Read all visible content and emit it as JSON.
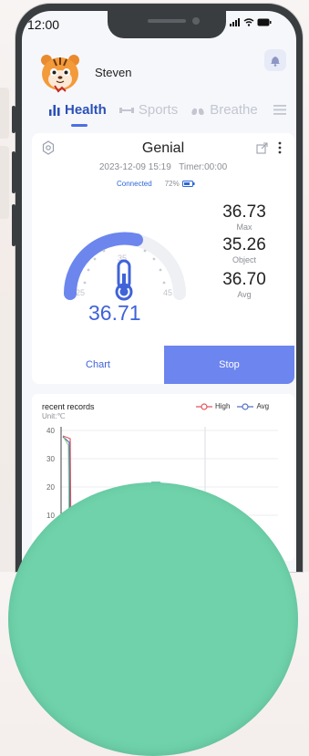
{
  "status_bar": {
    "time": "12:00"
  },
  "user": {
    "name": "Steven"
  },
  "tabs": [
    {
      "label": "Health",
      "icon": "bar-chart-icon",
      "active": true
    },
    {
      "label": "Sports",
      "icon": "dumbbell-icon",
      "active": false
    },
    {
      "label": "Breathe",
      "icon": "lungs-icon",
      "active": false
    }
  ],
  "device": {
    "name": "Genial",
    "datetime": "2023-12-09 15:19",
    "timer": "Timer:00:00",
    "connection": "Connected",
    "battery": "72%"
  },
  "gauge": {
    "min_label": "25",
    "mid_label": "35",
    "max_label": "45",
    "value": "36.71"
  },
  "stats": [
    {
      "value": "36.73",
      "label": "Max"
    },
    {
      "value": "35.26",
      "label": "Object"
    },
    {
      "value": "36.70",
      "label": "Avg"
    }
  ],
  "actions": {
    "chart_label": "Chart",
    "stop_label": "Stop"
  },
  "records": {
    "title": "recent records",
    "unit": "Unit:℃",
    "legend_high": "High",
    "legend_avg": "Avg",
    "y_ticks": [
      "40",
      "30",
      "20",
      "10"
    ]
  },
  "colors": {
    "accent": "#3f63d8",
    "button": "#6d85ee",
    "high": "#e2565b",
    "avg": "#5470c6",
    "bubble": "#6fd2aa"
  }
}
